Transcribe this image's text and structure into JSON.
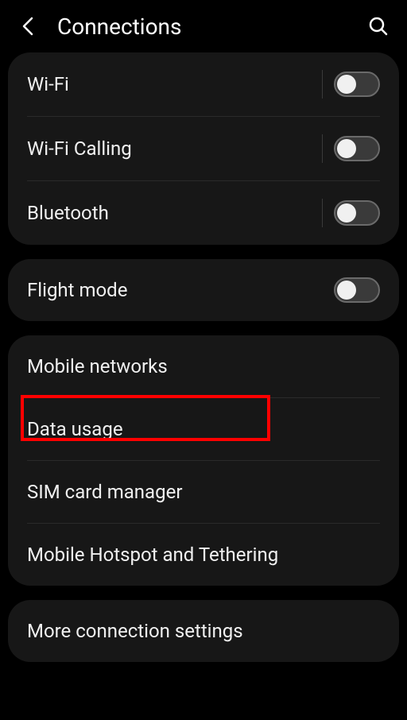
{
  "header": {
    "title": "Connections"
  },
  "groups": [
    {
      "items": [
        {
          "label": "Wi-Fi",
          "hasToggle": true,
          "hasVerticalDivider": true
        },
        {
          "label": "Wi-Fi Calling",
          "hasToggle": true,
          "hasVerticalDivider": true
        },
        {
          "label": "Bluetooth",
          "hasToggle": true,
          "hasVerticalDivider": true
        }
      ]
    },
    {
      "items": [
        {
          "label": "Flight mode",
          "hasToggle": true,
          "hasVerticalDivider": false
        }
      ]
    },
    {
      "items": [
        {
          "label": "Mobile networks",
          "hasToggle": false
        },
        {
          "label": "Data usage",
          "hasToggle": false,
          "highlighted": true
        },
        {
          "label": "SIM card manager",
          "hasToggle": false
        },
        {
          "label": "Mobile Hotspot and Tethering",
          "hasToggle": false
        }
      ]
    },
    {
      "items": [
        {
          "label": "More connection settings",
          "hasToggle": false
        }
      ]
    }
  ]
}
